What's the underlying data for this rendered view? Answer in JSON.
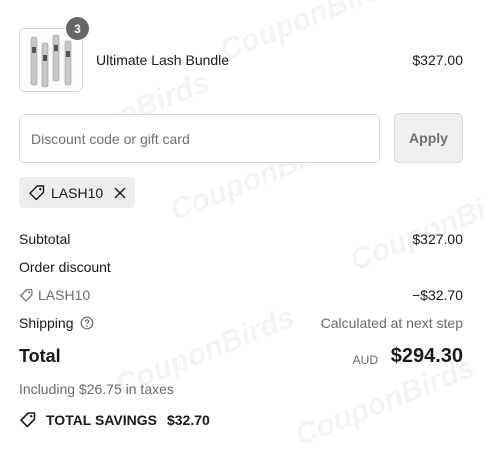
{
  "product": {
    "name": "Ultimate Lash Bundle",
    "price": "$327.00",
    "quantity": "3"
  },
  "discount": {
    "placeholder": "Discount code or gift card",
    "apply_label": "Apply",
    "applied_code": "LASH10"
  },
  "summary": {
    "subtotal_label": "Subtotal",
    "subtotal_value": "$327.00",
    "order_discount_label": "Order discount",
    "discount_code": "LASH10",
    "discount_value": "−$32.70",
    "shipping_label": "Shipping",
    "shipping_value": "Calculated at next step",
    "total_label": "Total",
    "currency": "AUD",
    "total_value": "$294.30",
    "taxes_note": "Including $26.75 in taxes",
    "savings_label": "TOTAL SAVINGS",
    "savings_value": "$32.70"
  },
  "icons": {
    "tag": "tag-icon",
    "close": "close-icon",
    "help": "help-circle-icon"
  }
}
